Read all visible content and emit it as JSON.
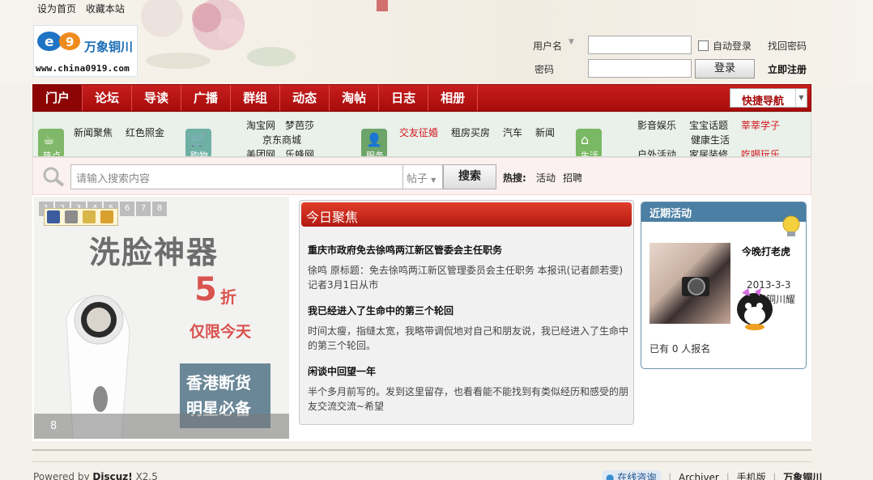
{
  "top_menu": {
    "set_home": "设为首页",
    "bookmark": "收藏本站"
  },
  "logo": {
    "brand": "万象铜川",
    "url": "www.china0919.com"
  },
  "login": {
    "username_label": "用户名",
    "password_label": "密码",
    "auto_login_label": "自动登录",
    "find_password": "找回密码",
    "login_button": "登录",
    "register": "立即注册"
  },
  "nav": {
    "items": [
      "门户",
      "论坛",
      "导读",
      "广播",
      "群组",
      "动态",
      "淘帖",
      "日志",
      "相册"
    ],
    "active_index": 0,
    "quick_nav": "快捷导航"
  },
  "categories": {
    "icons": [
      {
        "name": "热点",
        "color": "#7fb868"
      },
      {
        "name": "购物",
        "color": "#6fb0a5"
      },
      {
        "name": "服务",
        "color": "#6da46a"
      },
      {
        "name": "生活",
        "color": "#79b864"
      }
    ],
    "group1": [
      "新闻聚焦",
      "红色照金"
    ],
    "group2_top": [
      "淘宝网",
      "梦芭莎"
    ],
    "group2_mid": "京东商城",
    "group2_bot": [
      "美团网",
      "乐蜂网"
    ],
    "group3": [
      "交友征婚",
      "租房买房",
      "汽车",
      "新闻"
    ],
    "group4_top": [
      "影音娱乐",
      "宝宝话题",
      "莘莘学子"
    ],
    "group4_mid": "健康生活",
    "group4_bot": [
      "户外活动",
      "家居装修",
      "吃喝玩乐"
    ]
  },
  "search": {
    "placeholder": "请输入搜索内容",
    "type": "帖子",
    "button": "搜索",
    "hot_label": "热搜:",
    "hot_words": [
      "活动",
      "招聘"
    ]
  },
  "slider": {
    "pages": [
      "1",
      "2",
      "3",
      "4",
      "5",
      "6",
      "7",
      "8"
    ],
    "title": "洗脸神器",
    "discount_num": "5",
    "discount_unit": "折",
    "limit": "仅限今天",
    "stamp_line1": "香港断货",
    "stamp_line2": "明星必备",
    "caption_num": "8"
  },
  "news": {
    "header": "今日聚焦",
    "articles": [
      {
        "title": "重庆市政府免去徐鸣两江新区管委会主任职务",
        "text": "徐鸣 原标题：免去徐鸣两江新区管理委员会主任职务 本报讯(记者颜若雯)记者3月1日从市"
      },
      {
        "title": "我已经进入了生命中的第三个轮回",
        "text": "时间太瘦，指缝太宽，我略带调侃地对自己和朋友说，我已经进入了生命中的第三个轮回。"
      },
      {
        "title": "闲谈中回望一年",
        "text": "半个多月前写的。发到这里留存，也看看能不能找到有类似经历和感受的朋友交流交流~希望"
      }
    ]
  },
  "activity": {
    "header": "近期活动",
    "title": "今晚打老虎",
    "date": "2013-3-3",
    "location": "陕西铜川耀州区",
    "count_text": "已有 0 人报名"
  },
  "footer": {
    "powered_by": "Powered by",
    "discuz": "Discuz!",
    "version": "X2.5",
    "online_service": "在线咨询",
    "archiver": "Archiver",
    "mobile": "手机版",
    "site": "万象铜川"
  },
  "colors": {
    "nav_red": "#b51313",
    "accent_blue": "#4b7fa4"
  }
}
